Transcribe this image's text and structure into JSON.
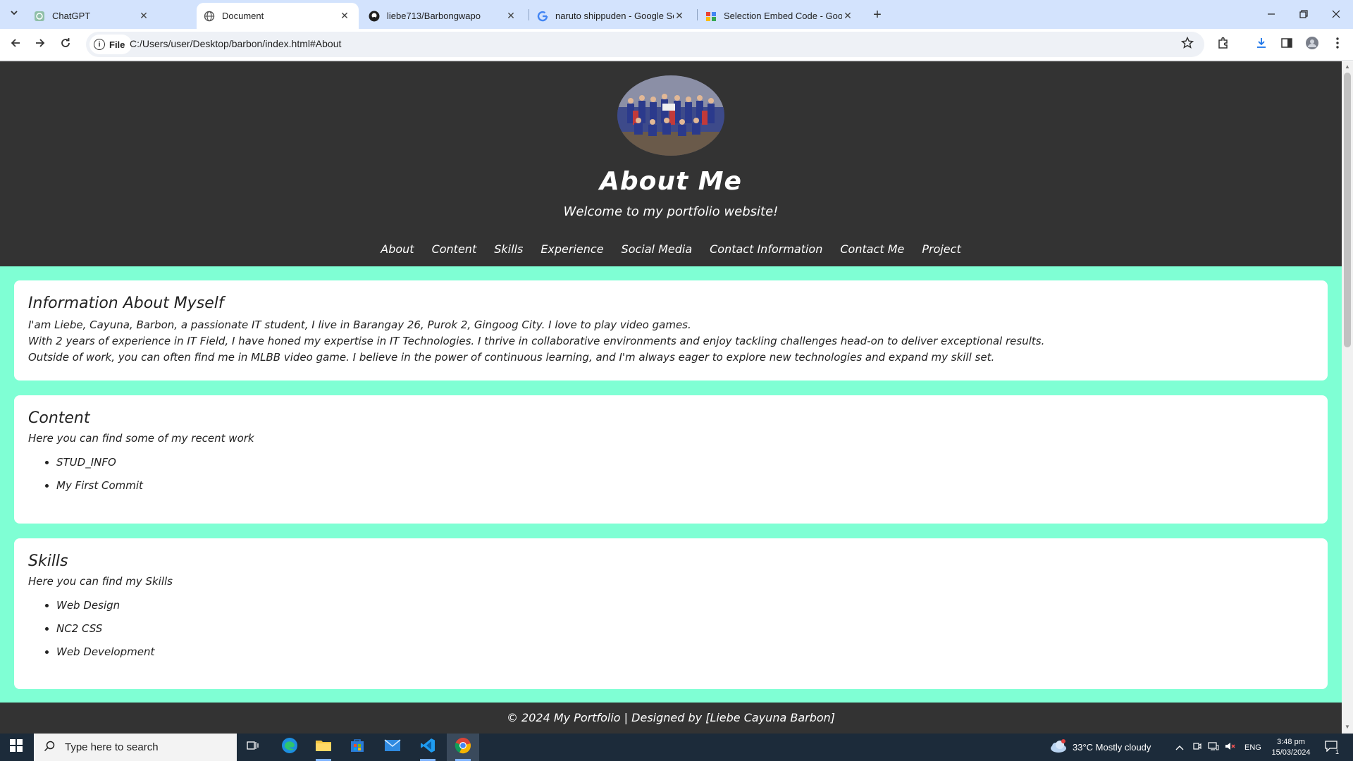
{
  "browser": {
    "tabs": [
      {
        "title": "ChatGPT",
        "icon": "chatgpt-icon",
        "active": false
      },
      {
        "title": "Document",
        "icon": "globe-icon",
        "active": true
      },
      {
        "title": "liebe713/Barbongwapo",
        "icon": "github-icon",
        "active": false
      },
      {
        "title": "naruto shippuden - Google Sea",
        "icon": "google-icon",
        "active": false
      },
      {
        "title": "Selection Embed Code - Googl",
        "icon": "sites-icon",
        "active": false
      }
    ],
    "site_chip": "File",
    "url": "C:/Users/user/Desktop/barbon/index.html#About"
  },
  "page": {
    "header": {
      "title": "About Me",
      "subtitle": "Welcome to my portfolio website!",
      "nav": [
        "About",
        "Content",
        "Skills",
        "Experience",
        "Social Media",
        "Contact Information",
        "Contact Me",
        "Project"
      ]
    },
    "about": {
      "heading": "Information About Myself",
      "lines": [
        "I'am Liebe, Cayuna, Barbon, a passionate IT student, I live in Barangay 26, Purok 2, Gingoog City. I love to play video games.",
        "With 2 years of experience in IT Field, I have honed my expertise in IT Technologies. I thrive in collaborative environments and enjoy tackling challenges head-on to deliver exceptional results.",
        "Outside of work, you can often find me in MLBB video game. I believe in the power of continuous learning, and I'm always eager to explore new technologies and expand my skill set."
      ]
    },
    "content": {
      "heading": "Content",
      "intro": "Here you can find some of my recent work",
      "items": [
        "STUD_INFO",
        "My First Commit"
      ]
    },
    "skills": {
      "heading": "Skills",
      "intro": "Here you can find my Skills",
      "items": [
        "Web Design",
        "NC2 CSS",
        "Web Development"
      ]
    },
    "footer": "© 2024 My Portfolio | Designed by [Liebe Cayuna Barbon]"
  },
  "taskbar": {
    "search_placeholder": "Type here to search",
    "weather": "33°C  Mostly cloudy",
    "language": "ENG",
    "time": "3:48 pm",
    "date": "15/03/2024",
    "notification_count": "1"
  },
  "colors": {
    "page_background": "#7fffd4",
    "header_background": "#333333",
    "tabstrip": "#d3e3fd"
  }
}
